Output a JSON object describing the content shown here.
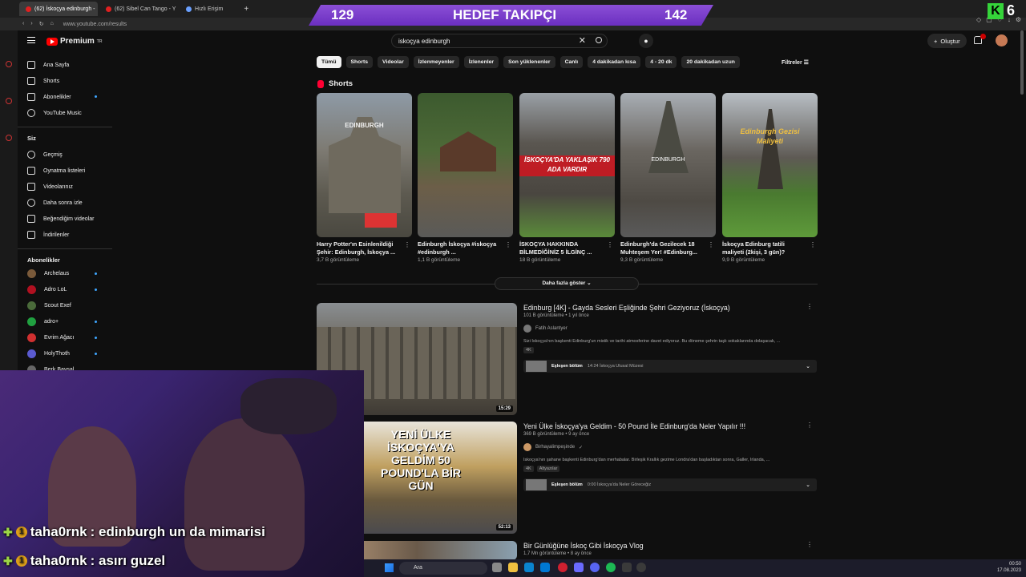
{
  "browser": {
    "tabs": [
      {
        "label": "(62) İskoçya edinburgh -",
        "active": true
      },
      {
        "label": "(62) Sibel Can Tango - Y",
        "active": false
      },
      {
        "label": "Hızlı Erişim",
        "active": false
      }
    ],
    "url": "www.youtube.com/results"
  },
  "overlay": {
    "banner_left": "129",
    "banner_title": "HEDEF TAKIPÇI",
    "banner_right": "142",
    "k_badge": "K",
    "k_count": "6"
  },
  "youtube": {
    "logo": "Premium",
    "logo_sup": "TR",
    "search_value": "iskoçya edinburgh",
    "create_label": "Oluştur",
    "notif_badge": "9+"
  },
  "sidebar": {
    "main": [
      "Ana Sayfa",
      "Shorts",
      "Abonelikler",
      "YouTube Music"
    ],
    "you_header": "Siz",
    "you": [
      "Geçmiş",
      "Oynatma listeleri",
      "Videolarınız",
      "Daha sonra izle",
      "Beğendiğim videolar",
      "İndirilenler"
    ],
    "subs_header": "Abonelikler",
    "subs": [
      {
        "name": "Archelaus",
        "color": "#7a5a3a"
      },
      {
        "name": "Adro LoL",
        "color": "#b01020"
      },
      {
        "name": "Scout Exef",
        "color": "#4a6a3a"
      },
      {
        "name": "adro+",
        "color": "#20a040"
      },
      {
        "name": "Evrim Ağacı",
        "color": "#d03030"
      },
      {
        "name": "HolyThoth",
        "color": "#5a5ad0"
      },
      {
        "name": "Berk Baysal",
        "color": "#666666"
      }
    ]
  },
  "chips": [
    "Tümü",
    "Shorts",
    "Videolar",
    "İzlenmeyenler",
    "İzlenenler",
    "Son yüklenenler",
    "Canlı",
    "4 dakikadan kısa",
    "4 - 20 dk",
    "20 dakikadan uzun"
  ],
  "filters_label": "Filtreler",
  "shorts": {
    "header": "Shorts",
    "items": [
      {
        "title": "Harry Potter'ın Esinlenildiği Şehir: Edinburgh, İskoçya ...",
        "views": "3,7 B görüntüleme",
        "overlay": "EDINBURGH"
      },
      {
        "title": "Edinburgh İskoçya #iskoçya #edinburgh ...",
        "views": "1,1 B görüntüleme",
        "overlay": ""
      },
      {
        "title": "İSKOÇYA HAKKINDA BİLMEDİĞİNİZ 5 İLGİNÇ ...",
        "views": "18 B görüntüleme",
        "overlay": "İSKOÇYA'DA YAKLAŞIK 790 ADA VARDIR"
      },
      {
        "title": "Edinburgh'da Gezilecek 18 Muhteşem Yer! #Edinburg...",
        "views": "9,3 B görüntüleme",
        "overlay": "EDINBURGH"
      },
      {
        "title": "İskoçya Edinburg tatili maliyeti (2kişi, 3 gün)?",
        "views": "9,9 B görüntüleme",
        "overlay": "Edinburgh Gezisi Maliyeti"
      }
    ],
    "show_more": "Daha fazla göster"
  },
  "videos": [
    {
      "title": "Edinburg [4K] - Gayda Sesleri Eşliğinde Şehri Geziyoruz (İskoçya)",
      "meta": "101 B görüntüleme • 1 yıl önce",
      "channel": "Fatih Aslantyer",
      "desc": "Sizi İskoçya'nın başkenti Edinburg'un mistik ve tarihi atmosferine davet ediyoruz. Bu döneme şehrin taşlı sokaklarında dolaşacak, ...",
      "badges": [
        "4K"
      ],
      "duration": "15:29",
      "moment_label": "Eşleşen bölüm",
      "moment_text": "14:24 İskoçya Ulusal Müzesi",
      "thumb_text": ""
    },
    {
      "title": "Yeni Ülke İskoçya'ya Geldim - 50 Pound İle Edinburg'da Neler Yapılır !!!",
      "meta": "369 B görüntüleme • 9 ay önce",
      "channel": "Birhayalimpeşinde",
      "desc": "İskoçya'nın şahane başkenti Edinburg'dan merhabalar. Birleşik Krallık gezime Londra'dan başladıktan sonra, Galler, İrlanda, ...",
      "badges": [
        "4K",
        "Altyazılar"
      ],
      "duration": "52:13",
      "moment_label": "Eşleşen bölüm",
      "moment_text": "0:00 İskoçya'da Neler Göreceğiz",
      "thumb_text": "YENİ ÜLKE İSKOÇYA'YA GELDİM 50 POUND'LA BİR GÜN"
    },
    {
      "title": "Bir Günlüğüne İskoç Gibi İskoçya Vlog",
      "meta": "1,7 Mn görüntüleme • 8 ay önce",
      "channel": "",
      "desc": "",
      "badges": [],
      "duration": "",
      "moment_label": "",
      "moment_text": "",
      "thumb_text": ""
    }
  ],
  "chat": [
    {
      "user": "taha0rnk",
      "message": ": edinburgh un da mimarisi"
    },
    {
      "user": "taha0rnk",
      "message": ": asırı guzel"
    }
  ],
  "taskbar": {
    "search": "Ara",
    "time": "00:50",
    "date": "17.08.2023"
  }
}
